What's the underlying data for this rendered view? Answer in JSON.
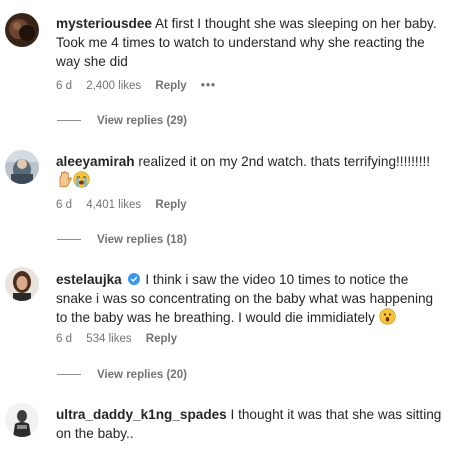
{
  "comments": [
    {
      "username": "mysteriousdee",
      "text": "At first I thought she was sleeping on her baby. Took me 4 times to watch to understand why she reacting the way she did",
      "time": "6 d",
      "likes": "2,400 likes",
      "reply_label": "Reply",
      "more": "•••",
      "view_replies": "View replies (29)"
    },
    {
      "username": "aleeyamirah",
      "text": "realized it on my 2nd watch. thats terrifying!!!!!!!!!",
      "time": "6 d",
      "likes": "4,401 likes",
      "reply_label": "Reply",
      "view_replies": "View replies (18)"
    },
    {
      "username": "estelaujka",
      "verified": true,
      "text": "I think i saw the video 10 times to notice the snake i was so concentrating on the baby what was happening to the baby was he breathing. I would die immidiately",
      "time": "6 d",
      "likes": "534 likes",
      "reply_label": "Reply",
      "view_replies": "View replies (20)"
    },
    {
      "username": "ultra_daddy_k1ng_spades",
      "text": "I thought it was that she was sitting on the baby.."
    }
  ],
  "icons": {
    "more": "more-options-icon",
    "verified": "verified-badge-icon",
    "emoji_hand": "raised-back-hand-emoji",
    "emoji_cry": "loudly-crying-face-emoji",
    "emoji_surprised": "astonished-face-emoji"
  },
  "colors": {
    "text": "#262626",
    "secondary": "#737373",
    "verified": "#3897f0"
  }
}
